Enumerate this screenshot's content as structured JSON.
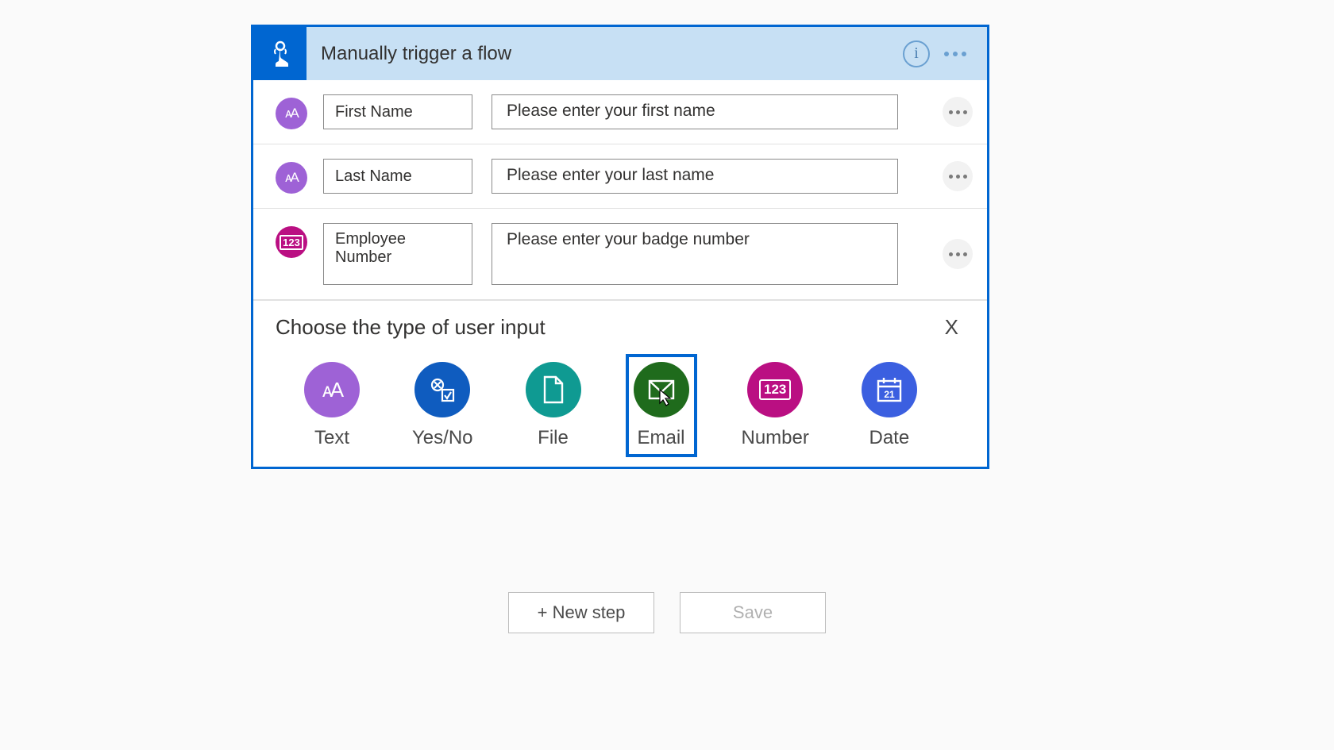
{
  "trigger": {
    "title": "Manually trigger a flow"
  },
  "inputs": [
    {
      "name": "First Name",
      "description": "Please enter your first name",
      "type": "text"
    },
    {
      "name": "Last Name",
      "description": "Please enter your last name",
      "type": "text"
    },
    {
      "name": "Employee Number",
      "description": "Please enter your badge number",
      "type": "number"
    }
  ],
  "input_type_picker": {
    "heading": "Choose the type of user input",
    "close_label": "X",
    "options": [
      {
        "label": "Text",
        "key": "text"
      },
      {
        "label": "Yes/No",
        "key": "yesno"
      },
      {
        "label": "File",
        "key": "file"
      },
      {
        "label": "Email",
        "key": "email"
      },
      {
        "label": "Number",
        "key": "number"
      },
      {
        "label": "Date",
        "key": "date"
      }
    ],
    "selected": "email"
  },
  "footer": {
    "new_step": "+ New step",
    "save": "Save"
  }
}
